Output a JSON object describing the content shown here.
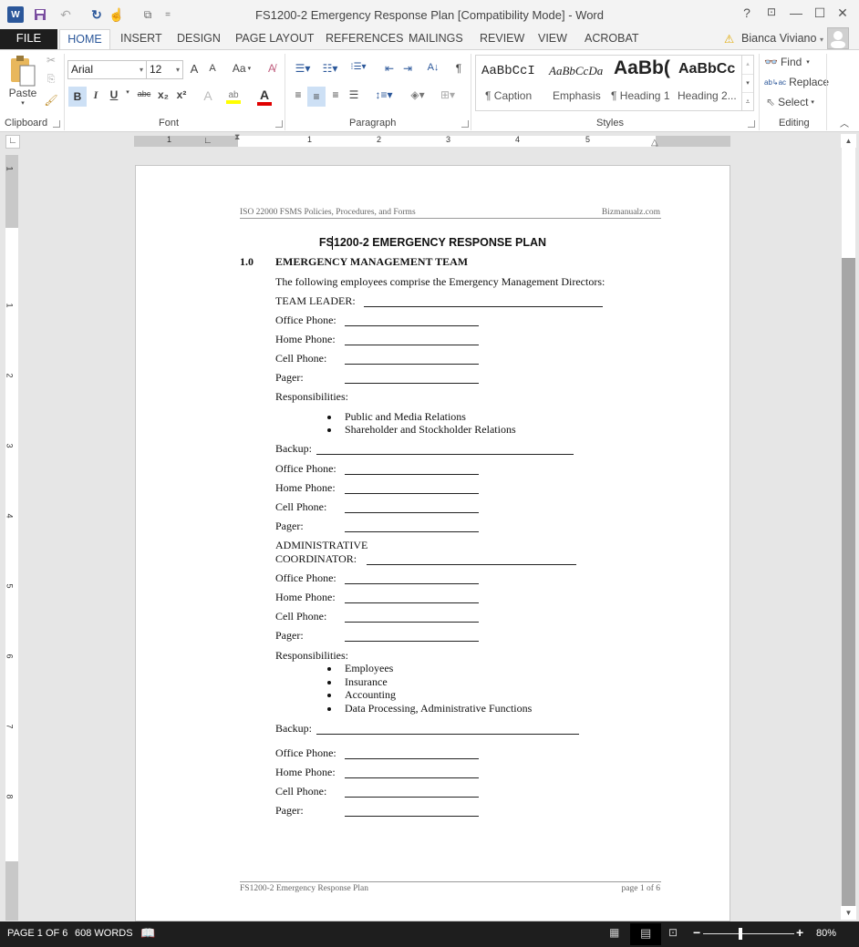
{
  "window": {
    "title": "FS1200-2 Emergency Response Plan [Compatibility Mode] - Word",
    "controls": {
      "help": "?",
      "restore_ribbon": "⊡",
      "minimize": "—",
      "maximize": "☐",
      "close": "✕"
    }
  },
  "quick_access": {
    "undo": "↶",
    "redo": "↻",
    "touch": "☝",
    "customize": "="
  },
  "tabs": {
    "file": "FILE",
    "items": [
      "HOME",
      "INSERT",
      "DESIGN",
      "PAGE LAYOUT",
      "REFERENCES",
      "MAILINGS",
      "REVIEW",
      "VIEW",
      "ACROBAT"
    ],
    "active": "HOME"
  },
  "user": {
    "name": "Bianca Viviano",
    "warning": "⚠"
  },
  "ribbon": {
    "clipboard": {
      "label": "Clipboard",
      "paste": "Paste"
    },
    "font": {
      "label": "Font",
      "family": "Arial",
      "size": "12",
      "grow": "A",
      "shrink": "A",
      "case": "Aa",
      "bold": "B",
      "italic": "I",
      "underline": "U",
      "strike": "abc",
      "subscript": "x₂",
      "superscript": "x²",
      "highlight_color": "#ffff00",
      "font_color": "#e00000"
    },
    "paragraph": {
      "label": "Paragraph",
      "pilcrow": "¶"
    },
    "styles": {
      "label": "Styles",
      "items": [
        {
          "preview": "AaBbCcI",
          "name": "¶ Caption"
        },
        {
          "preview": "AaBbCcDa",
          "name": "Emphasis"
        },
        {
          "preview": "AaBb(",
          "name": "¶ Heading 1"
        },
        {
          "preview": "AaBbCc",
          "name": "Heading 2..."
        }
      ]
    },
    "editing": {
      "label": "Editing",
      "find": "Find",
      "replace": "Replace",
      "select": "Select"
    }
  },
  "ruler": {
    "numbers": [
      "1",
      "1",
      "2",
      "3",
      "4",
      "5"
    ],
    "vnumbers": [
      "1",
      "1",
      "2",
      "3",
      "4",
      "5",
      "6",
      "7",
      "8"
    ]
  },
  "document": {
    "header_left": "ISO 22000 FSMS Policies, Procedures, and Forms",
    "header_right": "Bizmanualz.com",
    "title": "FS1200-2 EMERGENCY RESPONSE PLAN",
    "section_number": "1.0",
    "section_title": "EMERGENCY MANAGEMENT TEAM",
    "intro": "The following employees comprise the Emergency Management Directors:",
    "team_leader": "TEAM LEADER:",
    "office_phone": "Office Phone:",
    "home_phone": "Home Phone:",
    "cell_phone": "Cell Phone:",
    "pager": "Pager:",
    "responsibilities": "Responsibilities:",
    "leader_responsibilities": [
      "Public and Media Relations",
      "Shareholder and Stockholder Relations"
    ],
    "backup": "Backup:",
    "admin_line1": "ADMINISTRATIVE",
    "admin_line2": "COORDINATOR:",
    "admin_responsibilities": [
      "Employees",
      "Insurance",
      "Accounting",
      "Data Processing, Administrative Functions"
    ],
    "footer_left": "FS1200-2 Emergency Response Plan",
    "footer_right": "page 1 of 6"
  },
  "status": {
    "page": "PAGE 1 OF 6",
    "words": "608 WORDS",
    "zoom": "80%",
    "zoom_minus": "−",
    "zoom_plus": "+"
  }
}
